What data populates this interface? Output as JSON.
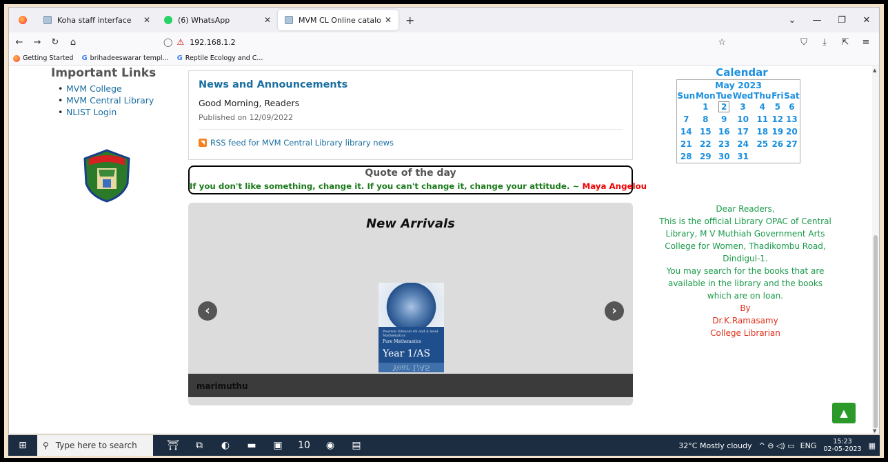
{
  "browser": {
    "tabs": [
      {
        "label": "Koha staff interface",
        "active": false
      },
      {
        "label": "(6) WhatsApp",
        "active": false
      },
      {
        "label": "MVM CL Online catalogue catal",
        "active": true
      }
    ],
    "url": "192.168.1.2",
    "bookmarks": [
      "Getting Started",
      "brihadeeswarar templ...",
      "Reptile Ecology and C..."
    ]
  },
  "important_links": {
    "title": "Important Links",
    "items": [
      "MVM College",
      "MVM Central Library",
      "NLIST Login"
    ]
  },
  "news": {
    "title": "News and Announcements",
    "greeting": "Good Morning, Readers",
    "published": "Published on 12/09/2022",
    "rss": "RSS feed for MVM Central Library library news"
  },
  "quote": {
    "title": "Quote of the day",
    "text": "If you don't like something, change it. If you can't change it, change your attitude. ~ ",
    "author": "Maya Angelou"
  },
  "arrivals": {
    "title": "New Arrivals",
    "caption": "marimuthu",
    "book_line1": "Pearson Edexcel AS and A level Mathematics",
    "book_line2": "Pure Mathematics",
    "book_line3": "Year 1/AS"
  },
  "calendar": {
    "title": "Calendar",
    "month": "May 2023",
    "days": [
      "Sun",
      "Mon",
      "Tue",
      "Wed",
      "Thu",
      "Fri",
      "Sat"
    ],
    "weeks": [
      [
        "",
        "1",
        "2",
        "3",
        "4",
        "5",
        "6"
      ],
      [
        "7",
        "8",
        "9",
        "10",
        "11",
        "12",
        "13"
      ],
      [
        "14",
        "15",
        "16",
        "17",
        "18",
        "19",
        "20"
      ],
      [
        "21",
        "22",
        "23",
        "24",
        "25",
        "26",
        "27"
      ],
      [
        "28",
        "29",
        "30",
        "31",
        "",
        "",
        ""
      ]
    ],
    "today": "2"
  },
  "welcome": {
    "l1": "Dear Readers,",
    "l2": "This is the official Library OPAC of Central Library, M V Muthiah Government Arts College for Women, Thadikombu Road, Dindigul-1.",
    "l3": "You may search for the books that are available in the library and the books which are on loan.",
    "l4": "By",
    "l5": "Dr.K.Ramasamy",
    "l6": "College Librarian"
  },
  "taskbar": {
    "search_placeholder": "Type here to search",
    "weather": "32°C  Mostly cloudy",
    "lang": "ENG",
    "time": "15:23",
    "date": "02-05-2023",
    "badge": "10"
  }
}
